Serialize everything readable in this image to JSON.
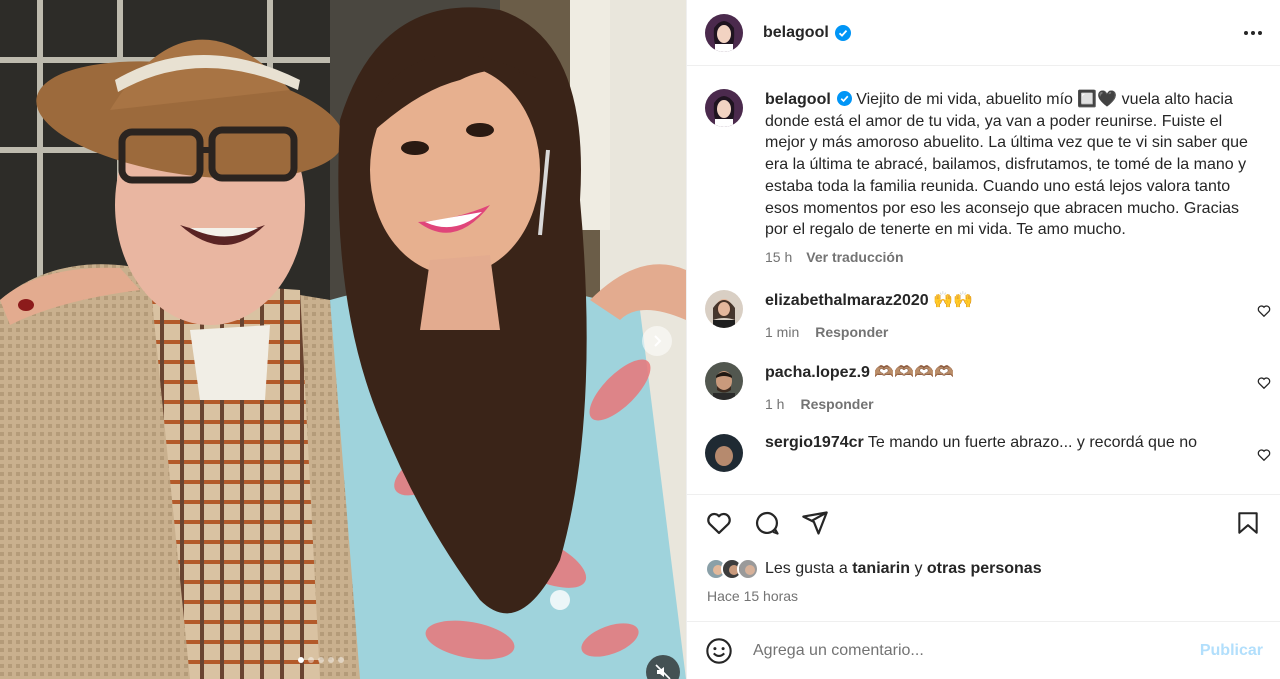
{
  "post": {
    "username": "belagool",
    "verified": true,
    "caption": "Viejito de mi vida, abuelito mío 🔲🖤 vuela alto hacia donde está el amor de tu vida, ya van a poder reunirse. Fuiste el mejor y más amoroso abuelito. La última vez que te vi sin saber que era la última te abracé, bailamos, disfrutamos, te tomé de la mano y estaba toda la familia reunida. Cuando uno está lejos valora tanto esos momentos por eso les aconsejo que abracen mucho. Gracias por el regalo de tenerte en mi vida. Te amo mucho.",
    "caption_time": "15 h",
    "translate_label": "Ver traducción"
  },
  "comments": [
    {
      "username": "elizabethalmaraz2020",
      "text": "🙌🙌",
      "time": "1 min",
      "reply_label": "Responder"
    },
    {
      "username": "pacha.lopez.9",
      "text": "🫶🏽🫶🏽🫶🏽🫶🏽",
      "time": "1 h",
      "reply_label": "Responder"
    },
    {
      "username": "sergio1974cr",
      "text": "Te mando un fuerte abrazo... y recordá que no",
      "time": "",
      "reply_label": ""
    }
  ],
  "likes": {
    "prefix": "Les gusta a",
    "user": "taniarin",
    "connector": "y",
    "others": "otras personas"
  },
  "post_age": "Hace 15 horas",
  "composer": {
    "placeholder": "Agrega un comentario...",
    "publish_label": "Publicar"
  },
  "carousel": {
    "count": 5,
    "active": 1
  },
  "colors": {
    "accent": "#0095f6",
    "publish_disabled": "#b2dffc",
    "verified": "#0095f6",
    "secondary_text": "#737373"
  },
  "icons": [
    "verified-badge-icon",
    "more-options-icon",
    "heart-icon",
    "comment-icon",
    "share-icon",
    "bookmark-icon",
    "emoji-icon",
    "chevron-right-icon",
    "mute-icon"
  ]
}
